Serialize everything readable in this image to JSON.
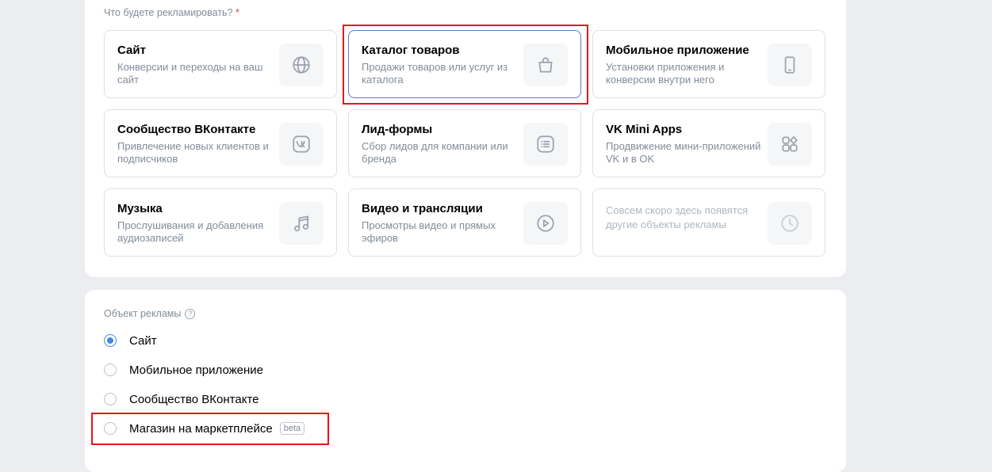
{
  "section_promote": {
    "label": "Что будете рекламировать?",
    "required_mark": "*",
    "tiles": [
      {
        "title": "Сайт",
        "desc": "Конверсии и переходы на ваш сайт",
        "icon": "globe-icon"
      },
      {
        "title": "Каталог товаров",
        "desc": "Продажи товаров или услуг из каталога",
        "icon": "shopping-bag-icon",
        "selected": true
      },
      {
        "title": "Мобильное приложение",
        "desc": "Установки приложения и конверсии внутри него",
        "icon": "smartphone-icon"
      },
      {
        "title": "Сообщество ВКонтакте",
        "desc": "Привлечение новых клиентов и подписчиков",
        "icon": "vk-logo-icon"
      },
      {
        "title": "Лид-формы",
        "desc": "Сбор лидов для компании или бренда",
        "icon": "list-icon"
      },
      {
        "title": "VK Mini Apps",
        "desc": "Продвижение мини-приложений VK и в OK",
        "icon": "apps-grid-icon"
      },
      {
        "title": "Музыка",
        "desc": "Прослушивания и добавления аудиозаписей",
        "icon": "music-note-icon"
      },
      {
        "title": "Видео и трансляции",
        "desc": "Просмотры видео и прямых эфиров",
        "icon": "play-circle-icon"
      },
      {
        "title": "",
        "desc": "Совсем скоро здесь появятся другие объекты рекламы",
        "icon": "clock-icon",
        "disabled": true
      }
    ]
  },
  "section_object": {
    "label": "Объект рекламы",
    "help_icon": "?",
    "options": [
      {
        "label": "Сайт",
        "checked": true
      },
      {
        "label": "Мобильное приложение",
        "checked": false
      },
      {
        "label": "Сообщество ВКонтакте",
        "checked": false
      },
      {
        "label": "Магазин на маркетплейсе",
        "checked": false,
        "badge": "beta"
      }
    ]
  },
  "colors": {
    "accent": "#3f8ae0",
    "highlight": "#e8141c",
    "selected_border": "#5181b8"
  }
}
